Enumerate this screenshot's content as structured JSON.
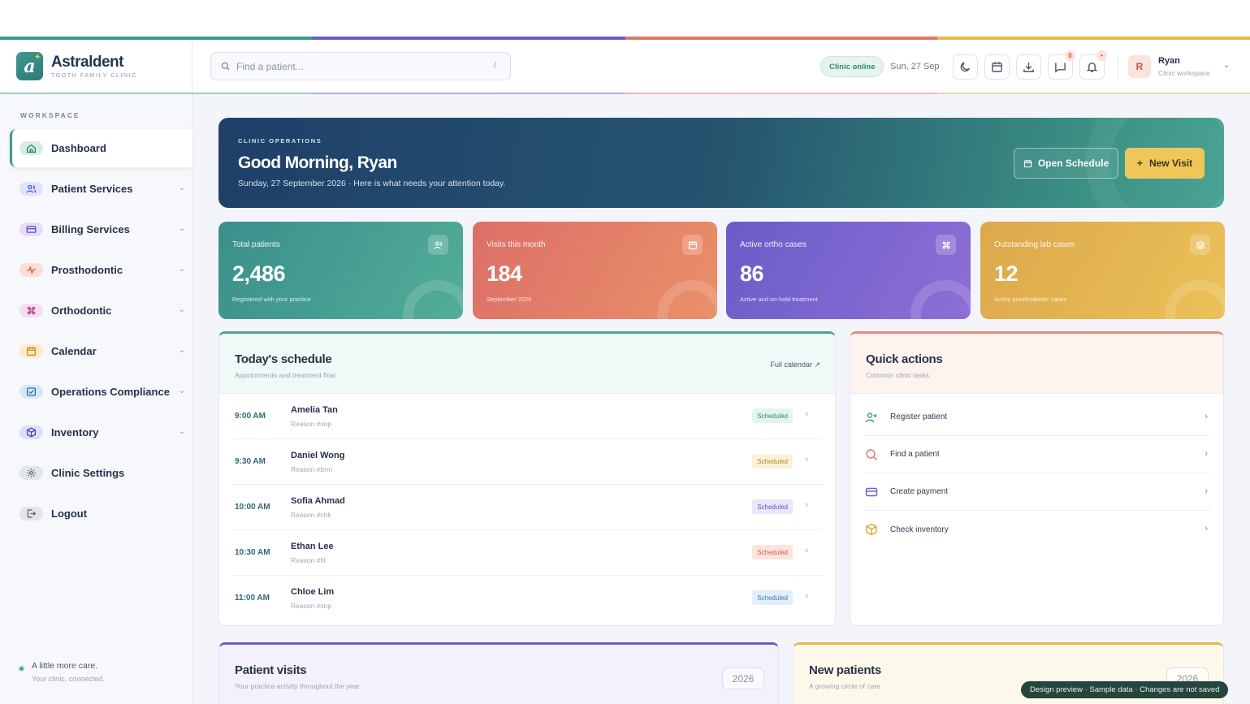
{
  "brand": {
    "logo_letter": "a",
    "name": "Astraldent",
    "tagline": "TOOTH FAMILY CLINIC"
  },
  "colors": {
    "teal": "#3e9a8c",
    "indigo": "#6a5cc8",
    "coral": "#e0776a",
    "gold": "#e6b94f",
    "navy": "#1f3f69"
  },
  "sidebar": {
    "section_label": "WORKSPACE",
    "items": [
      {
        "label": "Dashboard",
        "icon": "home-icon",
        "active": true,
        "expandable": false
      },
      {
        "label": "Patient Services",
        "icon": "users-icon",
        "expandable": true
      },
      {
        "label": "Billing Services",
        "icon": "credit-card-icon",
        "expandable": true
      },
      {
        "label": "Prosthodontic",
        "icon": "pulse-icon",
        "expandable": true
      },
      {
        "label": "Orthodontic",
        "icon": "command-icon",
        "expandable": true
      },
      {
        "label": "Calendar",
        "icon": "calendar-icon",
        "expandable": true
      },
      {
        "label": "Operations Compliance",
        "icon": "checkbox-icon",
        "expandable": true
      },
      {
        "label": "Inventory",
        "icon": "box-icon",
        "expandable": true
      },
      {
        "label": "Clinic Settings",
        "icon": "gear-icon",
        "expandable": false
      },
      {
        "label": "Logout",
        "icon": "logout-icon",
        "expandable": false
      }
    ],
    "footer": {
      "line1": "A little more care.",
      "line2": "Your clinic, connected."
    }
  },
  "header": {
    "search": {
      "placeholder": "Find a patient...",
      "shortcut": "/"
    },
    "status": "Clinic online",
    "date": "Sun, 27 Sep",
    "messages_count": "0",
    "notifications_indicator": "•",
    "user": {
      "initial": "R",
      "name": "Ryan",
      "role": "Clinic workspace"
    }
  },
  "hero": {
    "kicker": "CLINIC OPERATIONS",
    "title": "Good Morning, Ryan",
    "subtitle": "Sunday, 27 September 2026 · Here is what needs your attention today.",
    "open_schedule": "Open Schedule",
    "new_visit": "New Visit"
  },
  "stats": [
    {
      "label": "Total patients",
      "value": "2,486",
      "note": "Registered with your practice",
      "icon": "users-icon"
    },
    {
      "label": "Visits this month",
      "value": "184",
      "note": "September 2026",
      "icon": "calendar-icon"
    },
    {
      "label": "Active ortho cases",
      "value": "86",
      "note": "Active and on-hold treatment",
      "icon": "command-icon"
    },
    {
      "label": "Outstanding lab cases",
      "value": "12",
      "note": "Active prosthodontic cases",
      "icon": "layers-icon"
    }
  ],
  "schedule": {
    "title": "Today's schedule",
    "subtitle": "Appointments and treatment flow",
    "link": "Full calendar ↗",
    "rows": [
      {
        "time": "9:00 AM",
        "name": "Amelia Tan",
        "reason": "Reason #snp",
        "status": "Scheduled"
      },
      {
        "time": "9:30 AM",
        "name": "Daniel Wong",
        "reason": "Reason #brm",
        "status": "Scheduled"
      },
      {
        "time": "10:00 AM",
        "name": "Sofia Ahmad",
        "reason": "Reason #chk",
        "status": "Scheduled"
      },
      {
        "time": "10:30 AM",
        "name": "Ethan Lee",
        "reason": "Reason #fil",
        "status": "Scheduled"
      },
      {
        "time": "11:00 AM",
        "name": "Chloe Lim",
        "reason": "Reason #snp",
        "status": "Scheduled"
      }
    ]
  },
  "quick_actions": {
    "title": "Quick actions",
    "subtitle": "Common clinic tasks",
    "items": [
      {
        "label": "Register patient",
        "icon": "user-plus-icon"
      },
      {
        "label": "Find a patient",
        "icon": "search-icon"
      },
      {
        "label": "Create payment",
        "icon": "credit-card-icon"
      },
      {
        "label": "Check inventory",
        "icon": "box-icon"
      }
    ]
  },
  "patient_visits": {
    "title": "Patient visits",
    "subtitle": "Your practice activity throughout the year",
    "year": "2026"
  },
  "new_patients": {
    "title": "New patients",
    "subtitle": "A growing circle of care",
    "year": "2026"
  },
  "toast": "Design preview · Sample data · Changes are not saved"
}
